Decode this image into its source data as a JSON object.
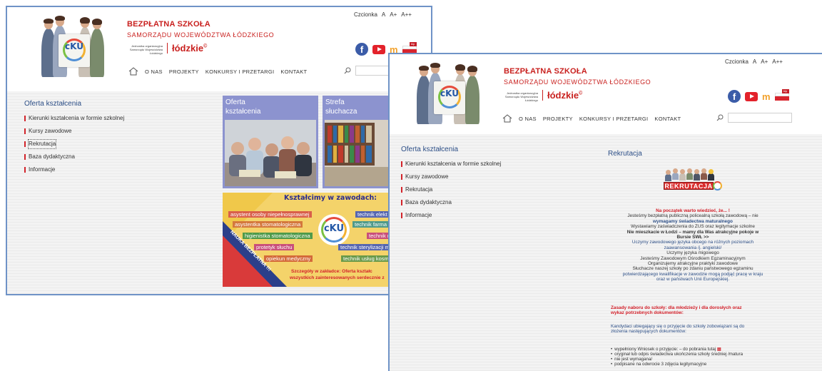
{
  "brand": {
    "line1": "BEZPŁATNA SZKOŁA",
    "line2": "SAMORZĄDU WOJEWÓDZTWA ŁÓDZKIEGO",
    "org_text": "Jednostka organizacyjna Samorządu Województwa Łódzkiego",
    "lodzkie": "łódzkie",
    "lodzkie_mark": "©",
    "logo_text": "cKU"
  },
  "font_size": {
    "label": "Czcionka",
    "a": "A",
    "a_plus": "A+",
    "a_plus_plus": "A++"
  },
  "social": {
    "facebook": "f",
    "mn": "m",
    "flag_tag": "bip"
  },
  "nav": {
    "items": [
      "O NAS",
      "PROJEKTY",
      "KONKURSY I PRZETARGI",
      "KONTAKT"
    ]
  },
  "sidebar": {
    "title": "Oferta kształcenia",
    "items": [
      "Kierunki kształcenia w formie szkolnej",
      "Kursy zawodowe",
      "Rekrutacja",
      "Baza dydaktyczna",
      "Informacje"
    ]
  },
  "tiles": {
    "oferta": {
      "line1": "Oferta",
      "line2": "kształcenia"
    },
    "strefa": {
      "line1": "Strefa",
      "line2": "słuchacza"
    }
  },
  "banner": {
    "title": "Kształcimy w zawodach:",
    "left": [
      "asystent osoby niepełnosprawnej",
      "asystentka stomatologiczna",
      "higienistka stomatologiczna",
      "protetyk słuchu",
      "opiekun medyczny"
    ],
    "right": [
      "technik elekt",
      "technik farma",
      "technik r",
      "technik sterylizacji m",
      "technik usług kosm"
    ],
    "diagonal": "NAUKA BEZPŁATNA !!!",
    "footer1": "Szczegóły w zakładce: Oferta kształc",
    "footer2": "wszystkich zainteresowanych serdecznie z"
  },
  "content": {
    "title": "Rekrutacja",
    "rek_label": "REKRUTACJA",
    "intro": "Na początek warto wiedzieć, że... !",
    "lines": [
      {
        "t": "Jesteśmy bezpłatną publiczną policealną szkołą zawodową – nie",
        "c": "mixed"
      },
      {
        "t": "wymagamy świadectwa maturalnego",
        "c": "bluebold"
      },
      {
        "t": "Wystawiamy zaświadczenia do ZUS oraz legitymacje szkolne",
        "c": ""
      },
      {
        "t": "Nie mieszkacie w Łodzi – mamy dla Was atrakcyjne pokoje w",
        "c": "bold"
      },
      {
        "t": "Bursie SWŁ >>",
        "c": "bold"
      },
      {
        "t": "Uczymy zawodowego języka obcego na różnych poziomach",
        "c": "blue"
      },
      {
        "t": "zaawansowania /j. angielski/",
        "c": "blue"
      },
      {
        "t": "Uczymy języka migowego",
        "c": ""
      },
      {
        "t": "Jesteśmy Zawodowym Ośrodkiem Egzaminacyjnym",
        "c": ""
      },
      {
        "t": "Organizujemy atrakcyjne praktyki zawodowe",
        "c": ""
      },
      {
        "t": "Słuchacze naszej szkoły po zdaniu państwowego egzaminu",
        "c": ""
      },
      {
        "t": "potwierdzającego kwalifikacje w zawodzie mogą podjąć pracę w kraju",
        "c": "blue"
      },
      {
        "t": "oraz w państwach Unii Europejskiej.",
        "c": "blue"
      }
    ],
    "zasady1": "Zasady naboru do szkoły: dla młodzieży i dla dorosłych oraz",
    "zasady2": "wykaz potrzebnych dokumentów:",
    "kand1": "Kandydaci ubiegający się o przyjęcie do szkoły zobowiązani są do",
    "kand2": "złożenia następujących dokumentów:",
    "bullets": [
      "wypełniony Wniosek o przyjęcie: – do pobrania tutaj",
      "oryginał lub odpis świadectwa ukończenia szkoły średniej /matura",
      "nie jest wymagana/",
      "podpisane na odwrocie 3 zdjęcia legitymacyjne"
    ]
  },
  "colors": {
    "brand_red": "#c9211f",
    "nav_blue": "#2d4f87",
    "tile_purple": "#8c93cf",
    "banner_yellow": "#f4d36a",
    "window_border": "#6f93c7"
  }
}
